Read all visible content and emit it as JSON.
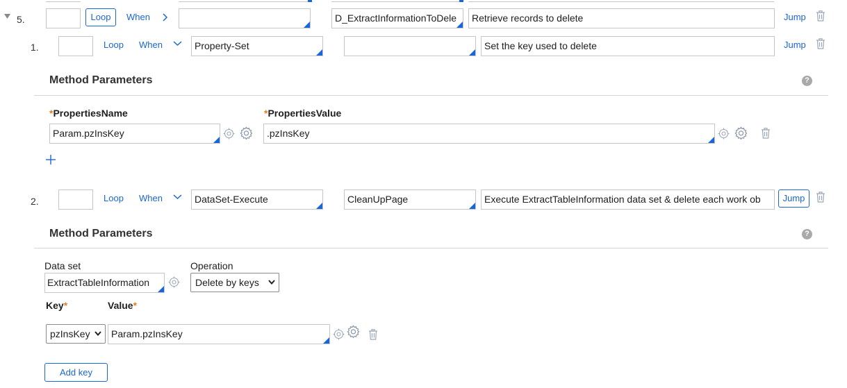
{
  "rows": [
    {
      "number": "5.",
      "loop_label": "Loop",
      "when_label": "When",
      "method_value": "",
      "step_page_value": "D_ExtractInformationToDele",
      "description_value": "Retrieve records to delete",
      "jump_label": "Jump"
    },
    {
      "number": "1.",
      "loop_label": "Loop",
      "when_label": "When",
      "method_value": "Property-Set",
      "step_page_value": "",
      "description_value": "Set the key used to delete",
      "jump_label": "Jump"
    },
    {
      "number": "2.",
      "loop_label": "Loop",
      "when_label": "When",
      "method_value": "DataSet-Execute",
      "step_page_value": "CleanUpPage",
      "description_value": "Execute ExtractTableInformation data set & delete each work ob",
      "jump_label": "Jump"
    }
  ],
  "property_set_params": {
    "title": "Method Parameters",
    "help_glyph": "?",
    "col_name_label": "PropertiesName",
    "col_value_label": "PropertiesValue",
    "required_mark": "*",
    "name_value": "Param.pzInsKey",
    "value_value": ".pzInsKey",
    "add_glyph": "+"
  },
  "dataset_params": {
    "title": "Method Parameters",
    "help_glyph": "?",
    "data_set_label": "Data set",
    "data_set_value": "ExtractTableInformation",
    "operation_label": "Operation",
    "operation_value": "Delete by keys",
    "key_label": "Key",
    "value_label": "Value",
    "required_mark": "*",
    "key_value": "pzInsKey",
    "value_value": "Param.pzInsKey",
    "add_key_label": "Add key"
  },
  "colors": {
    "accent": "#1a66d6",
    "required": "#d9822b",
    "border": "#c6c6c6"
  }
}
